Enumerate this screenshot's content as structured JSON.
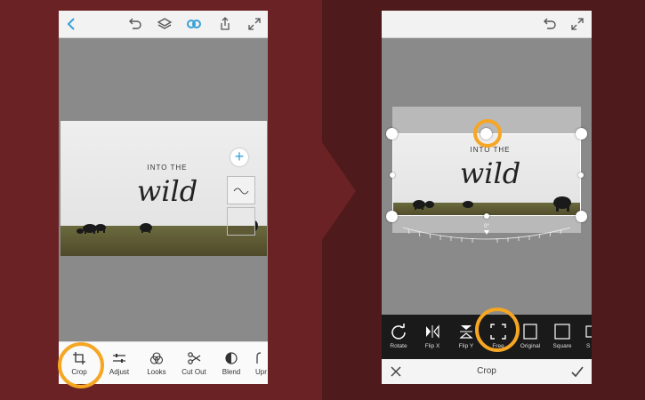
{
  "left_phone": {
    "bottom_tools": [
      {
        "label": "Crop",
        "icon": "crop-icon"
      },
      {
        "label": "Adjust",
        "icon": "sliders-icon"
      },
      {
        "label": "Looks",
        "icon": "looks-icon"
      },
      {
        "label": "Cut Out",
        "icon": "scissors-icon"
      },
      {
        "label": "Blend",
        "icon": "blend-icon"
      },
      {
        "label": "Upr",
        "icon": "upright-icon"
      }
    ]
  },
  "right_phone": {
    "crop_tools": [
      {
        "label": "Rotate",
        "icon": "rotate-icon"
      },
      {
        "label": "Flip X",
        "icon": "flip-x-icon"
      },
      {
        "label": "Flip Y",
        "icon": "flip-y-icon"
      },
      {
        "label": "Free",
        "icon": "free-crop-icon"
      },
      {
        "label": "Original",
        "icon": "original-ratio-icon"
      },
      {
        "label": "Square",
        "icon": "square-ratio-icon"
      },
      {
        "label": "S",
        "icon": "ratio-icon"
      }
    ],
    "footer_title": "Crop",
    "angle_readout": "0°"
  },
  "photo": {
    "headline_small": "INTO THE",
    "headline_script": "wild"
  },
  "colors": {
    "accent": "#3aa0d8",
    "highlight": "#f5a623"
  }
}
